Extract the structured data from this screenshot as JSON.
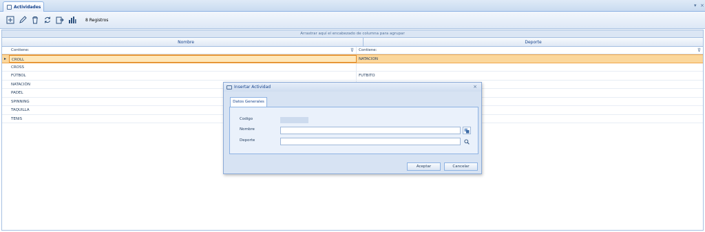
{
  "tab": {
    "title": "Actividades"
  },
  "window_controls": {
    "pin": "▾",
    "close": "×"
  },
  "toolbar": {
    "record_count": "8 Registros"
  },
  "grid": {
    "group_hint": "Arrastrar aquí el encabezado de columna para agrupar",
    "columns": [
      "Nombre",
      "Deporte"
    ],
    "filter": {
      "nombre": "Contiene:",
      "deporte": "Contiene:"
    },
    "rows": [
      {
        "nombre": "CROLL",
        "deporte": "NATACION"
      },
      {
        "nombre": "CROSS",
        "deporte": ""
      },
      {
        "nombre": "FÚTBOL",
        "deporte": "FUTBITO"
      },
      {
        "nombre": "NATACIÓN",
        "deporte": ""
      },
      {
        "nombre": "PADEL",
        "deporte": ""
      },
      {
        "nombre": "SPINNING",
        "deporte": ""
      },
      {
        "nombre": "TAQUILLA",
        "deporte": ""
      },
      {
        "nombre": "TENIS",
        "deporte": ""
      }
    ]
  },
  "dialog": {
    "title": "Insertar Actividad",
    "tab_label": "Datos Generales",
    "fields": {
      "codigo": "Codigo",
      "nombre": "Nombre",
      "deporte": "Deporte"
    },
    "accept": "Aceptar",
    "cancel": "Cancelar"
  }
}
